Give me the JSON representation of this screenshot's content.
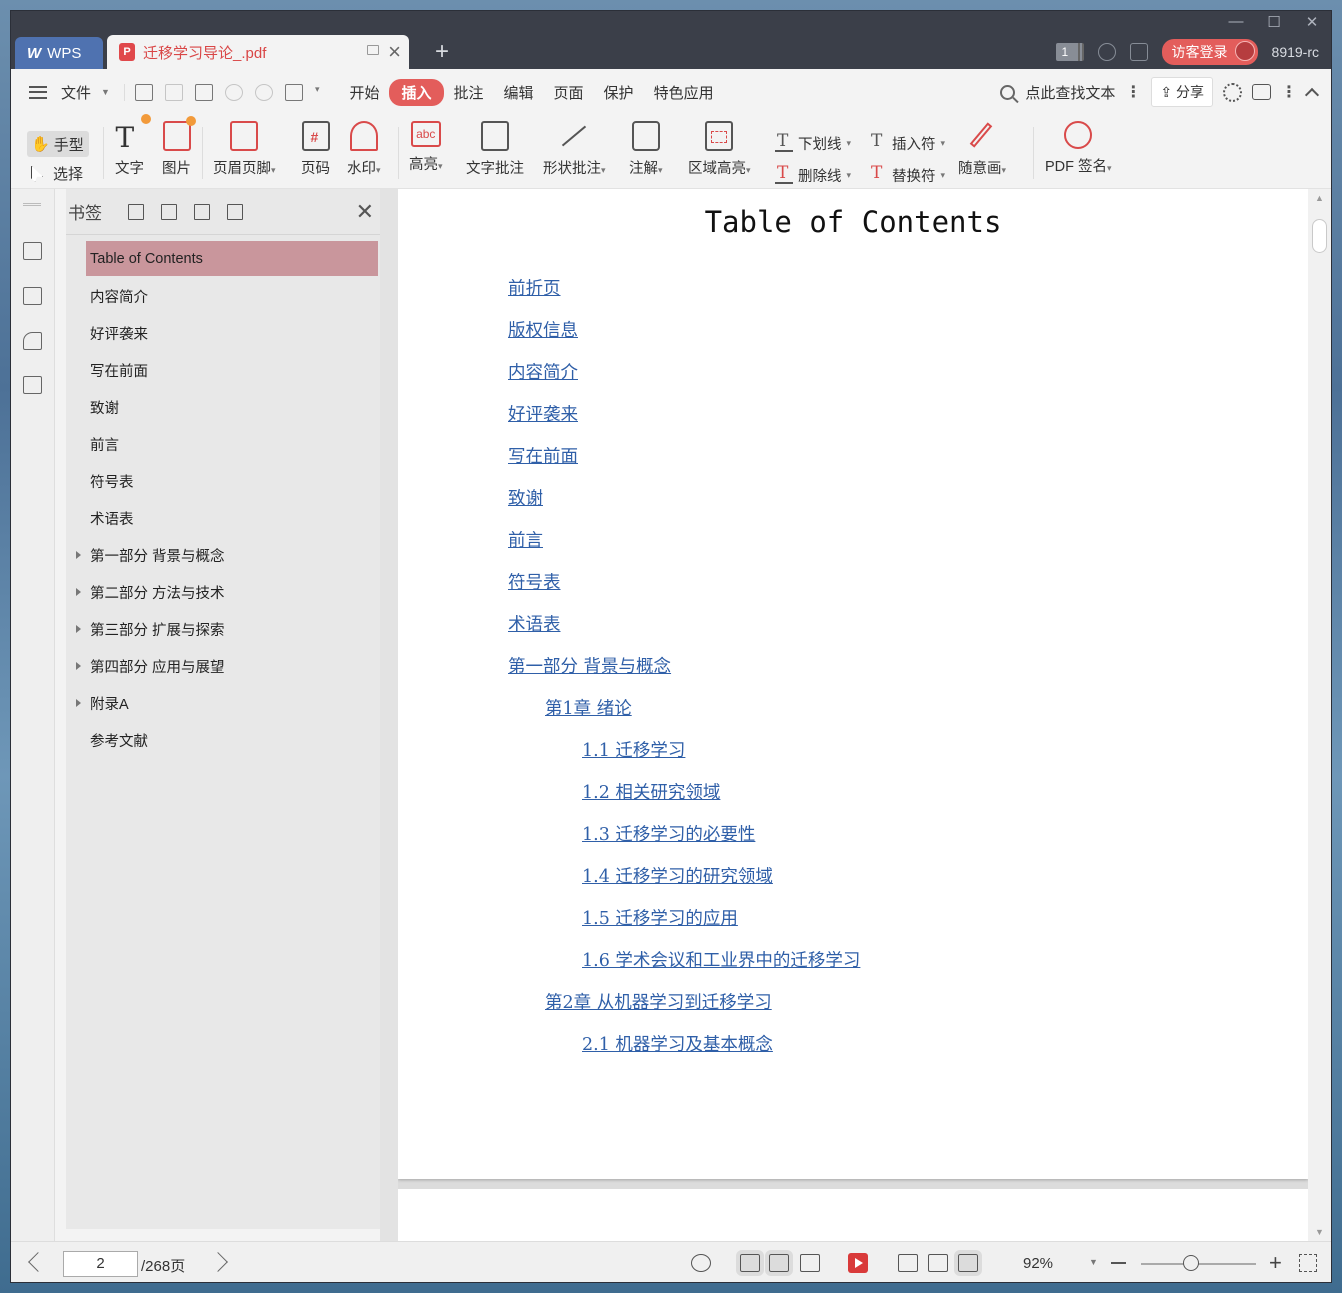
{
  "titlebar": {
    "app_tab": "WPS",
    "doc_tab": "迁移学习导论_.pdf",
    "page_badge": "1",
    "login_button": "访客登录",
    "account": "8919-rc"
  },
  "menubar": {
    "file": "文件",
    "tabs": [
      "开始",
      "插入",
      "批注",
      "编辑",
      "页面",
      "保护",
      "特色应用"
    ],
    "active_tab": "插入",
    "search_label": "点此查找文本",
    "share": "分享"
  },
  "ribbon": {
    "hand": "手型",
    "select": "选择",
    "text": "文字",
    "image": "图片",
    "header_footer": "页眉页脚",
    "page_number": "页码",
    "watermark": "水印",
    "highlight": "高亮",
    "text_comment": "文字批注",
    "shape_comment": "形状批注",
    "note": "注解",
    "area_highlight": "区域高亮",
    "underline": "下划线",
    "strikethrough": "删除线",
    "insert_char": "插入符",
    "replace_char": "替换符",
    "freehand": "随意画",
    "pdf_sign": "PDF 签名"
  },
  "bookmarks": {
    "title": "书签",
    "items": [
      {
        "label": "Table of Contents",
        "expandable": false,
        "selected": true
      },
      {
        "label": "内容简介",
        "expandable": false
      },
      {
        "label": "好评袭来",
        "expandable": false
      },
      {
        "label": "写在前面",
        "expandable": false
      },
      {
        "label": "致谢",
        "expandable": false
      },
      {
        "label": "前言",
        "expandable": false
      },
      {
        "label": "符号表",
        "expandable": false
      },
      {
        "label": "术语表",
        "expandable": false
      },
      {
        "label": "第一部分  背景与概念",
        "expandable": true
      },
      {
        "label": "第二部分  方法与技术",
        "expandable": true
      },
      {
        "label": "第三部分  扩展与探索",
        "expandable": true
      },
      {
        "label": "第四部分  应用与展望",
        "expandable": true
      },
      {
        "label": "附录A",
        "expandable": true
      },
      {
        "label": "参考文献",
        "expandable": false
      }
    ]
  },
  "document": {
    "title": "Table of Contents",
    "entries": [
      {
        "text": "前折页",
        "level": 1
      },
      {
        "text": "版权信息",
        "level": 1
      },
      {
        "text": "内容简介",
        "level": 1
      },
      {
        "text": "好评袭来",
        "level": 1
      },
      {
        "text": "写在前面",
        "level": 1
      },
      {
        "text": "致谢",
        "level": 1
      },
      {
        "text": "前言",
        "level": 1
      },
      {
        "text": "符号表",
        "level": 1
      },
      {
        "text": "术语表",
        "level": 1
      },
      {
        "text": "第一部分  背景与概念",
        "level": 1
      },
      {
        "text": "第1章  绪论",
        "level": 2
      },
      {
        "text": "1.1  迁移学习",
        "level": 3
      },
      {
        "text": "1.2  相关研究领域",
        "level": 3
      },
      {
        "text": "1.3  迁移学习的必要性",
        "level": 3
      },
      {
        "text": "1.4  迁移学习的研究领域",
        "level": 3
      },
      {
        "text": "1.5  迁移学习的应用",
        "level": 3
      },
      {
        "text": "1.6  学术会议和工业界中的迁移学习",
        "level": 3
      },
      {
        "text": "第2章  从机器学习到迁移学习",
        "level": 2
      },
      {
        "text": "2.1  机器学习及基本概念",
        "level": 3
      }
    ]
  },
  "statusbar": {
    "current_page": "2",
    "total_pages": "/268页",
    "zoom": "92%"
  },
  "colors": {
    "accent": "#e35d5b",
    "bookmark_selected": "#c9969c",
    "link": "#2f5fa8"
  }
}
